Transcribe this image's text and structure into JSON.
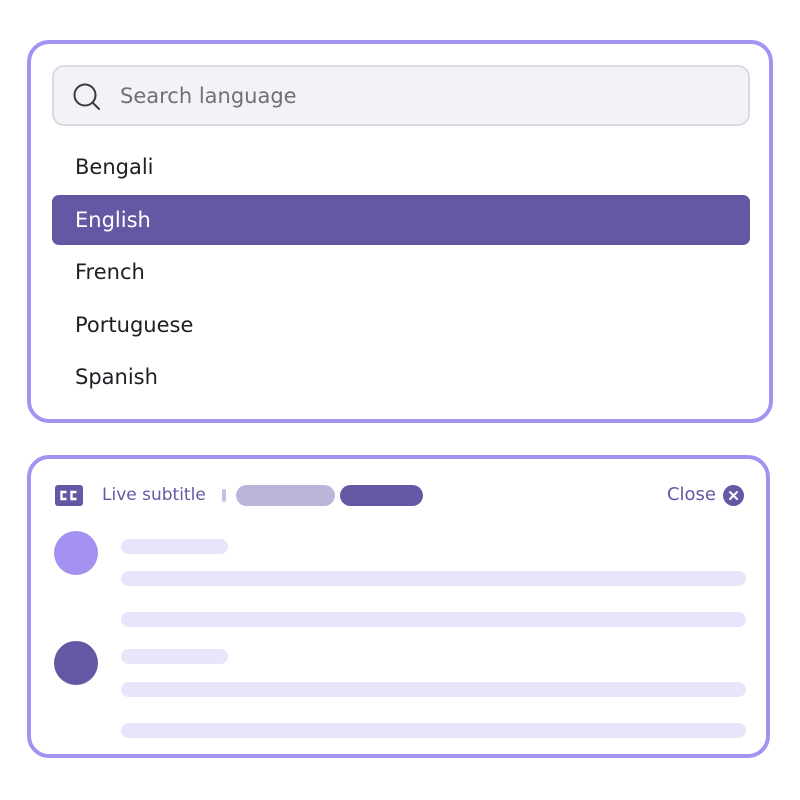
{
  "language_picker": {
    "search": {
      "placeholder": "Search language",
      "value": "",
      "icon": "search-icon"
    },
    "languages": [
      {
        "label": "Bengali",
        "selected": false
      },
      {
        "label": "English",
        "selected": true
      },
      {
        "label": "French",
        "selected": false
      },
      {
        "label": "Portuguese",
        "selected": false
      },
      {
        "label": "Spanish",
        "selected": false
      }
    ]
  },
  "subtitle_panel": {
    "icon": "closed-captions-icon",
    "title": "Live subtitle",
    "close_label": "Close",
    "close_icon": "close-circle-icon"
  },
  "colors": {
    "accent": "#6458a4",
    "border": "#a591f2",
    "placeholder_bar": "#e9e4fa",
    "pill_light": "#bcb5da"
  }
}
